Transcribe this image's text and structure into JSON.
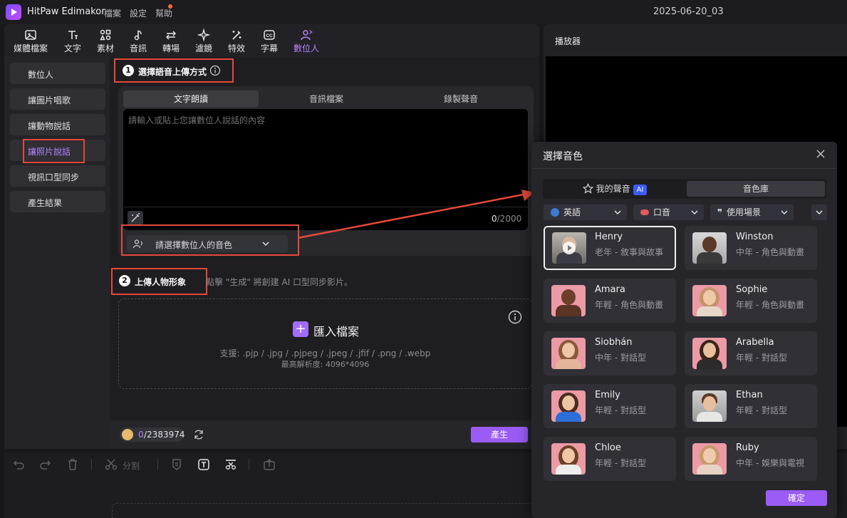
{
  "app": {
    "name": "HitPaw Edimakor",
    "menu": [
      "檔案",
      "設定",
      "幫助"
    ],
    "document_title": "2025-06-20_03"
  },
  "toolbar": {
    "items": [
      {
        "label": "媒體檔案",
        "icon": "media-icon"
      },
      {
        "label": "文字",
        "icon": "text-icon"
      },
      {
        "label": "素材",
        "icon": "elements-icon"
      },
      {
        "label": "音訊",
        "icon": "music-note-icon"
      },
      {
        "label": "轉場",
        "icon": "transition-icon"
      },
      {
        "label": "濾鏡",
        "icon": "filter-sparkle-icon"
      },
      {
        "label": "特效",
        "icon": "effects-icon"
      },
      {
        "label": "字幕",
        "icon": "cc-subtitle-icon"
      },
      {
        "label": "數位人",
        "icon": "digital-human-icon",
        "active": true
      }
    ]
  },
  "sidebar": {
    "items": [
      {
        "label": "數位人"
      },
      {
        "label": "讓圖片唱歌"
      },
      {
        "label": "讓動物說話"
      },
      {
        "label": "讓照片說話",
        "active": true
      },
      {
        "label": "視訊口型同步"
      },
      {
        "label": "產生結果"
      }
    ]
  },
  "step1": {
    "number": "1",
    "title": "選擇語音上傳方式",
    "tabs": [
      "文字朗讀",
      "音訊檔案",
      "錄製聲音"
    ],
    "text_placeholder": "請輸入或貼上您讓數位人說話的內容",
    "char_count": "0",
    "char_max": "/2000",
    "voice_select_label": "請選擇數位人的音色"
  },
  "step2": {
    "number": "2",
    "title": "上傳人物形象",
    "hint": "點擊 \"生成\" 將創建 AI 口型同步影片。",
    "import_label": "匯入檔案",
    "supported_formats": "支援: .pjp / .jpg / .pjpeg / .jpeg / .jfif / .png / .webp",
    "max_resolution": "最高解析度: 4096*4096"
  },
  "footer": {
    "credits_used": "0",
    "credits_total": "/2383974",
    "generate_label": "產生"
  },
  "timeline": {
    "split_label": "分割"
  },
  "player": {
    "title": "播放器"
  },
  "voice_dialog": {
    "title": "選擇音色",
    "tabs": [
      {
        "label": "我的聲音",
        "badge": "AI"
      },
      {
        "label": "音色庫",
        "active": true
      }
    ],
    "filters": [
      {
        "label": "英語",
        "icon": "globe-icon"
      },
      {
        "label": "口音",
        "icon": "mouth-icon"
      },
      {
        "label": "使用場景",
        "icon": "quote-icon"
      }
    ],
    "voices": [
      {
        "name": "Henry",
        "desc": "老年 - 敘事與故事",
        "selected": true
      },
      {
        "name": "Winston",
        "desc": "中年 - 角色與動畫"
      },
      {
        "name": "Amara",
        "desc": "年輕 - 角色與動畫"
      },
      {
        "name": "Sophie",
        "desc": "年輕 - 角色與動畫"
      },
      {
        "name": "Siobhán",
        "desc": "中年 - 對話型"
      },
      {
        "name": "Arabella",
        "desc": "年輕 - 對話型"
      },
      {
        "name": "Emily",
        "desc": "年輕 - 對話型"
      },
      {
        "name": "Ethan",
        "desc": "年輕 - 對話型"
      },
      {
        "name": "Chloe",
        "desc": "年輕 - 對話型"
      },
      {
        "name": "Ruby",
        "desc": "中年 - 娛樂與電視"
      }
    ],
    "confirm_label": "確定"
  },
  "colors": {
    "accent": "#9b5cf5",
    "highlight_red": "#e5483a"
  }
}
